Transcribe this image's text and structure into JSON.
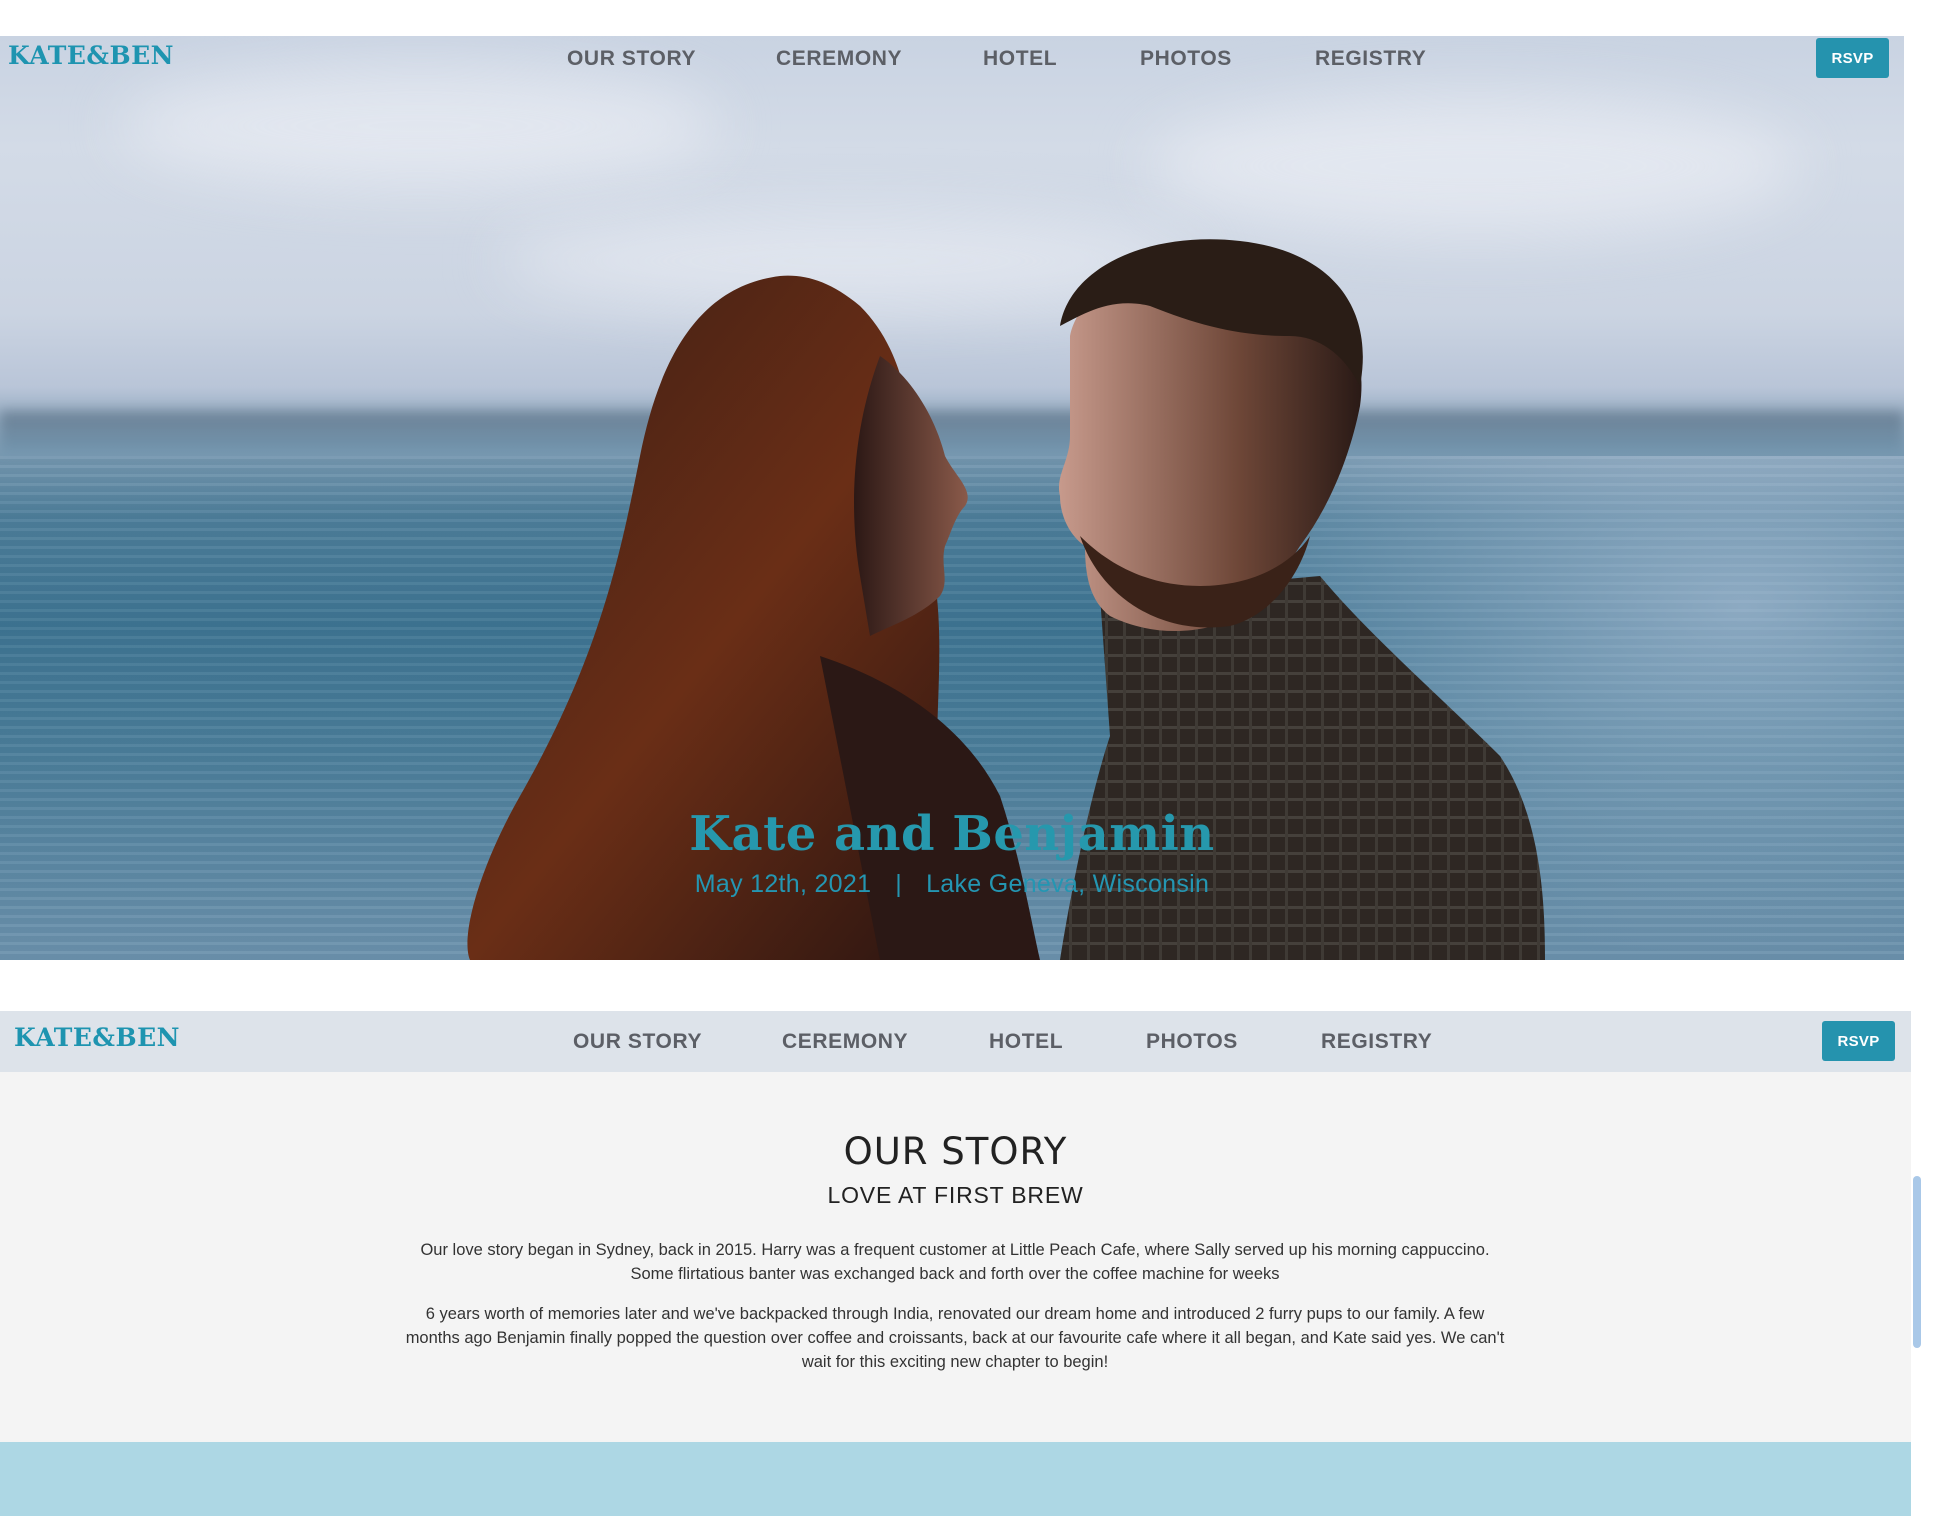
{
  "brand": {
    "logo_text": "KATE&BEN",
    "accent": "#2593ae"
  },
  "nav": {
    "items": [
      {
        "label": "OUR STORY"
      },
      {
        "label": "CEREMONY"
      },
      {
        "label": "HOTEL"
      },
      {
        "label": "PHOTOS"
      },
      {
        "label": "REGISTRY"
      }
    ],
    "rsvp_label": "RSVP"
  },
  "hero": {
    "title": "Kate and Benjamin",
    "date": "May 12th, 2021",
    "separator": "|",
    "location": "Lake Geneva, Wisconsin",
    "image_alt_icon": "couple-photo"
  },
  "story": {
    "heading": "OUR STORY",
    "subheading": "LOVE AT FIRST BREW",
    "paragraphs": [
      "Our love story began in Sydney, back in 2015. Harry was a frequent customer at Little Peach Cafe, where Sally served up his morning cappuccino. Some flirtatious banter was exchanged back and forth over the coffee machine for weeks",
      "6 years worth of memories later and we've backpacked through India, renovated our dream home and introduced 2 furry pups to our family. A few months ago Benjamin finally popped the question over coffee and croissants, back at our favourite cafe where it all began, and Kate said yes. We can't wait for this exciting new chapter to begin!"
    ]
  }
}
